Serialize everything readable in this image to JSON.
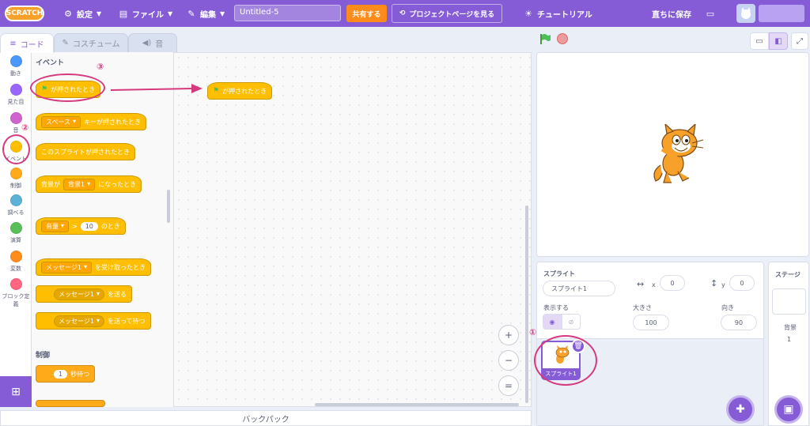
{
  "menubar": {
    "logo": "SCRATCH",
    "settings": "設定",
    "file": "ファイル",
    "edit": "編集",
    "project_title": "Untitled-5",
    "share": "共有する",
    "see_project_page": "プロジェクトページを見る",
    "tutorials": "チュートリアル",
    "save_now": "直ちに保存"
  },
  "tabs": {
    "code": "コード",
    "costumes": "コスチューム",
    "sounds": "音"
  },
  "categories": [
    {
      "label": "動き",
      "color": "#4c97ff"
    },
    {
      "label": "見た目",
      "color": "#9966ff"
    },
    {
      "label": "音",
      "color": "#cf63cf"
    },
    {
      "label": "イベント",
      "color": "#ffbf00"
    },
    {
      "label": "制御",
      "color": "#ffab19"
    },
    {
      "label": "調べる",
      "color": "#5cb1d6"
    },
    {
      "label": "演算",
      "color": "#59c059"
    },
    {
      "label": "変数",
      "color": "#ff8c1a"
    },
    {
      "label": "ブロック定義",
      "color": "#ff6680"
    }
  ],
  "palette": {
    "events_heading": "イベント",
    "control_heading": "制御",
    "when_flag": "が押されたとき",
    "key_dropdown": "スペース",
    "key_pressed": "キーが押されたとき",
    "sprite_clicked": "このスプライトが押されたとき",
    "backdrop_prefix": "背景が",
    "backdrop_dropdown": "背景1",
    "backdrop_suffix": "になったとき",
    "loudness_dropdown": "音量",
    "gt": ">",
    "loudness_value": "10",
    "loudness_suffix": "のとき",
    "message_dropdown": "メッセージ1",
    "when_receive": "を受け取ったとき",
    "broadcast": "を送る",
    "broadcast_wait": "を送って待つ",
    "wait_value": "1",
    "wait_suffix": "秒待つ"
  },
  "script": {
    "when_flag": "が押されたとき"
  },
  "zoom": {
    "in": "+",
    "out": "−",
    "reset": "="
  },
  "backpack": "バックパック",
  "sprite_info": {
    "sprite_label": "スプライト",
    "sprite_name": "スプライト1",
    "x_label": "x",
    "x_value": "0",
    "y_label": "y",
    "y_value": "0",
    "show_label": "表示する",
    "size_label": "大きさ",
    "size_value": "100",
    "direction_label": "向き",
    "direction_value": "90"
  },
  "sprite_thumb_name": "スプライト1",
  "stage_panel": {
    "title": "ステージ",
    "backdrops_label": "背景",
    "backdrops_count": "1"
  },
  "annotations": {
    "one": "①",
    "two": "②",
    "three": "③"
  }
}
